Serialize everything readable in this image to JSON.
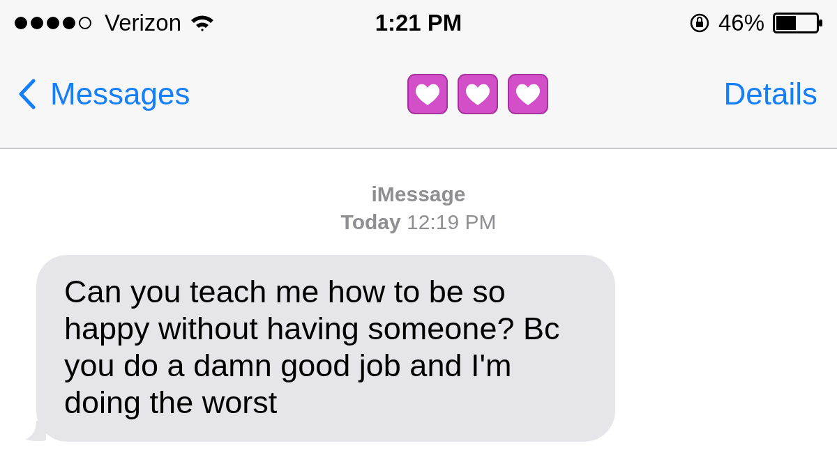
{
  "status_bar": {
    "carrier": "Verizon",
    "time": "1:21 PM",
    "battery": "46%"
  },
  "nav": {
    "back": "Messages",
    "title_icons": [
      {
        "kind": "heart"
      },
      {
        "kind": "heart"
      },
      {
        "kind": "heart"
      }
    ],
    "action": "Details"
  },
  "header": {
    "service": "iMessage",
    "timestamp": "**Today** 12:19 PM"
  },
  "messages": [
    {
      "kind": "received",
      "text": "Can you teach me how to be so happy without having someone? Bc you do a damn good job and I'm doing the worst"
    }
  ]
}
